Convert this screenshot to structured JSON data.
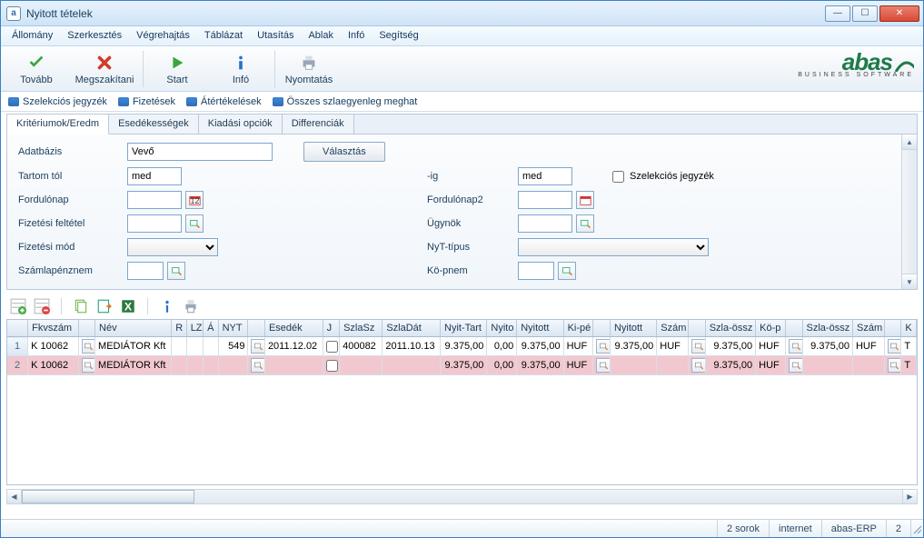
{
  "window": {
    "title": "Nyitott tételek"
  },
  "menu": [
    "Állomány",
    "Szerkesztés",
    "Végrehajtás",
    "Táblázat",
    "Utasítás",
    "Ablak",
    "Infó",
    "Segítség"
  ],
  "toolbar": [
    {
      "id": "continue",
      "label": "Tovább"
    },
    {
      "id": "abort",
      "label": "Megszakítani"
    },
    {
      "id": "start",
      "label": "Start"
    },
    {
      "id": "info",
      "label": "Infó"
    },
    {
      "id": "print",
      "label": "Nyomtatás"
    }
  ],
  "logo": {
    "brand": "abas",
    "sub": "BUSINESS SOFTWARE"
  },
  "links": [
    "Szelekciós jegyzék",
    "Fizetések",
    "Átértékelések",
    "Összes szlaegyenleg meghat"
  ],
  "tabs": [
    "Kritériumok/Eredm",
    "Esedékességek",
    "Kiadási opciók",
    "Differenciák"
  ],
  "active_tab": 0,
  "form": {
    "adatbazis": {
      "label": "Adatbázis",
      "value": "Vevő",
      "button": "Választás"
    },
    "tartom_tol": {
      "label": "Tartom tól",
      "value": "med"
    },
    "ig": {
      "label": "-ig",
      "value": "med"
    },
    "szel_jegyzek": {
      "label": "Szelekciós jegyzék",
      "checked": false
    },
    "fordulonap": {
      "label": "Fordulónap",
      "value": ""
    },
    "fordulonap2": {
      "label": "Fordulónap2",
      "value": ""
    },
    "fizetesi_feltetel": {
      "label": "Fizetési feltétel",
      "value": ""
    },
    "ugynok": {
      "label": "Ügynök",
      "value": ""
    },
    "fizetesi_mod": {
      "label": "Fizetési mód",
      "value": ""
    },
    "nyt_tipus": {
      "label": "NyT-típus",
      "value": ""
    },
    "szamlapenznem": {
      "label": "Számlapénznem",
      "value": ""
    },
    "ko_pnem": {
      "label": "Kö-pnem",
      "value": ""
    }
  },
  "grid": {
    "columns": [
      "",
      "Fkvszám",
      "",
      "Név",
      "R",
      "LZ",
      "Á",
      "NYT",
      "",
      "Esedék",
      "J",
      "SzlaSz",
      "SzlaDát",
      "Nyit-Tart",
      "Nyito",
      "Nyitott",
      "Ki-pé",
      "",
      "Nyitott",
      "Szám",
      "",
      "Szla-össz",
      "Kö-p",
      "",
      "Szla-össz",
      "Szám",
      "",
      "K"
    ],
    "rows": [
      {
        "n": "1",
        "fkv": "K 10062",
        "nev": "MEDIÁTOR Kft",
        "nyt": "549",
        "esedek": "2011.12.02",
        "szlasz": "400082",
        "szladat": "2011.10.13",
        "nyittart": "9.375,00",
        "nyito": "0,00",
        "nyitott": "9.375,00",
        "kipe": "HUF",
        "nyitott2": "9.375,00",
        "szam": "HUF",
        "szlaossz": "9.375,00",
        "kop": "HUF",
        "szlaossz2": "9.375,00",
        "szam2": "HUF",
        "k": "T"
      },
      {
        "n": "2",
        "fkv": "K 10062",
        "nev": "MEDIÁTOR Kft",
        "nyt": "",
        "esedek": "",
        "szlasz": "",
        "szladat": "",
        "nyittart": "9.375,00",
        "nyito": "0,00",
        "nyitott": "9.375,00",
        "kipe": "HUF",
        "nyitott2": "",
        "szam": "",
        "szlaossz": "9.375,00",
        "kop": "HUF",
        "szlaossz2": "",
        "szam2": "",
        "k": "T"
      }
    ]
  },
  "status": {
    "rows": "2 sorok",
    "net": "internet",
    "app": "abas-ERP",
    "num": "2"
  }
}
